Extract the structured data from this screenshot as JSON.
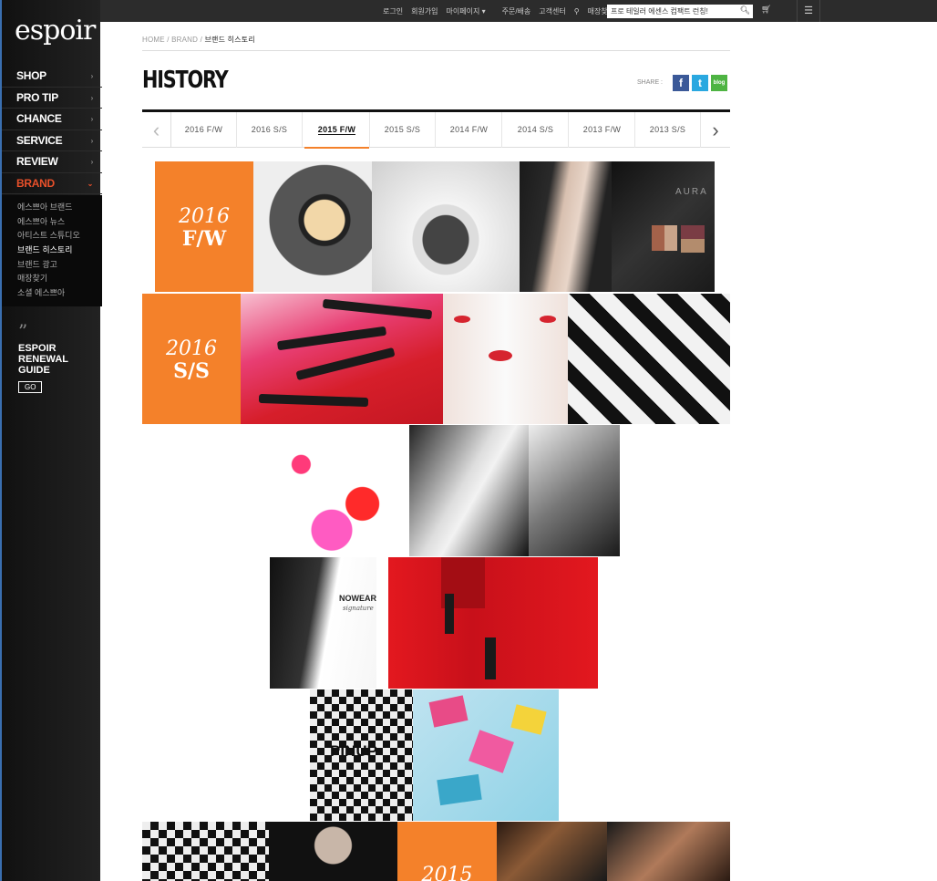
{
  "brand": {
    "logo": "espoir"
  },
  "sidebar": {
    "menu": [
      {
        "label": "SHOP"
      },
      {
        "label": "PRO TIP"
      },
      {
        "label": "CHANCE"
      },
      {
        "label": "SERVICE"
      },
      {
        "label": "REVIEW"
      },
      {
        "label": "BRAND"
      }
    ],
    "submenu": [
      {
        "label": "에스쁘아 브랜드"
      },
      {
        "label": "에스쁘아 뉴스"
      },
      {
        "label": "아티스트 스튜디오"
      },
      {
        "label": "브랜드 히스토리"
      },
      {
        "label": "브랜드 광고"
      },
      {
        "label": "매장찾기"
      },
      {
        "label": "소셜 에스쁘아"
      }
    ],
    "renewal": {
      "quote": "”",
      "line1": "ESPOIR",
      "line2": "RENEWAL",
      "line3": "GUIDE",
      "go": "GO"
    }
  },
  "topbar": {
    "links": [
      "로그인",
      "회원가입",
      "마이페이지 ▾",
      "주문/배송",
      "고객센터",
      "매장찾기"
    ],
    "search_value": "프로 테일러 에센스 컴팩트 런칭!",
    "search_icon": "search-icon",
    "cart_icon": "cart-icon",
    "menu_icon": "hamburger-icon"
  },
  "breadcrumb": {
    "home": "HOME",
    "sep": "/",
    "brand": "BRAND",
    "current": "브랜드 히스토리"
  },
  "page": {
    "title": "HISTORY",
    "share_label": "SHARE :",
    "share_fb": "f",
    "share_tw": "t",
    "share_blog": "blog"
  },
  "tabs": {
    "items": [
      "2016 F/W",
      "2016 S/S",
      "2015 F/W",
      "2015 S/S",
      "2014 F/W",
      "2014 S/S",
      "2013 F/W",
      "2013 S/S"
    ],
    "active": "2015 F/W",
    "prev": "‹",
    "next": "›"
  },
  "gallery": {
    "row1": {
      "year": "2016",
      "season": "F/W"
    },
    "row2": {
      "year": "2016",
      "season": "S/S"
    },
    "row6": {
      "year": "2015"
    },
    "nowear_text": "NOWEAR",
    "nowear_sub": "signature",
    "pinup_text": "PINUP",
    "aura_text": "AURA"
  },
  "colors": {
    "accent": "#f4812a",
    "brand_red": "#e8502a"
  }
}
